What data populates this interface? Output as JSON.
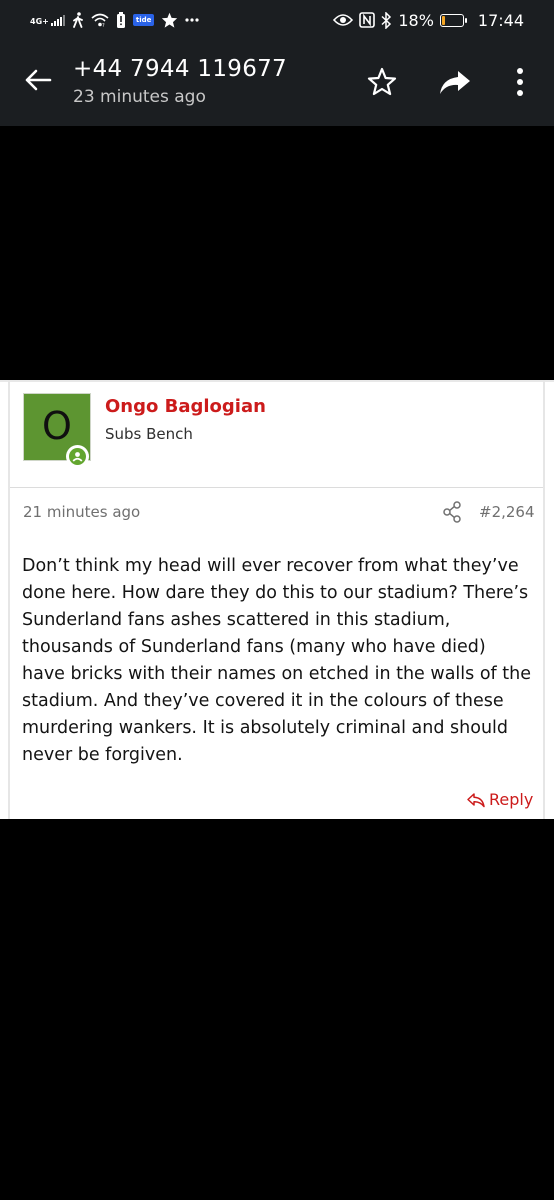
{
  "status_bar": {
    "network": "4G+",
    "battery_percent": "18%",
    "battery_level": 0.18,
    "time": "17:44",
    "tide_badge": "tide",
    "icons": [
      "signal-icon",
      "walking-icon",
      "wifi-icon",
      "battery-alert-icon",
      "tide-icon",
      "star-icon",
      "dots-icon",
      "eye-icon",
      "nfc-icon",
      "bluetooth-icon"
    ]
  },
  "app_bar": {
    "title": "+44 7944 119677",
    "subtitle": "23 minutes ago"
  },
  "post": {
    "avatar_letter": "O",
    "avatar_color": "#5d9531",
    "username": "Ongo Baglogian",
    "user_title": "Subs Bench",
    "date": "21 minutes ago",
    "post_number": "#2,264",
    "body": "Don’t think my head will ever recover from what they’ve done here. How dare they do this to our stadium? There’s Sunderland fans ashes scattered in this stadium, thousands of Sunderland fans (many who have died) have bricks with their names on etched in the walls of the stadium. And they’ve covered it in the colours of these murdering wankers. It is absolutely criminal and should never be forgiven.",
    "reply_label": "Reply",
    "accent_color": "#cc1b1b"
  }
}
